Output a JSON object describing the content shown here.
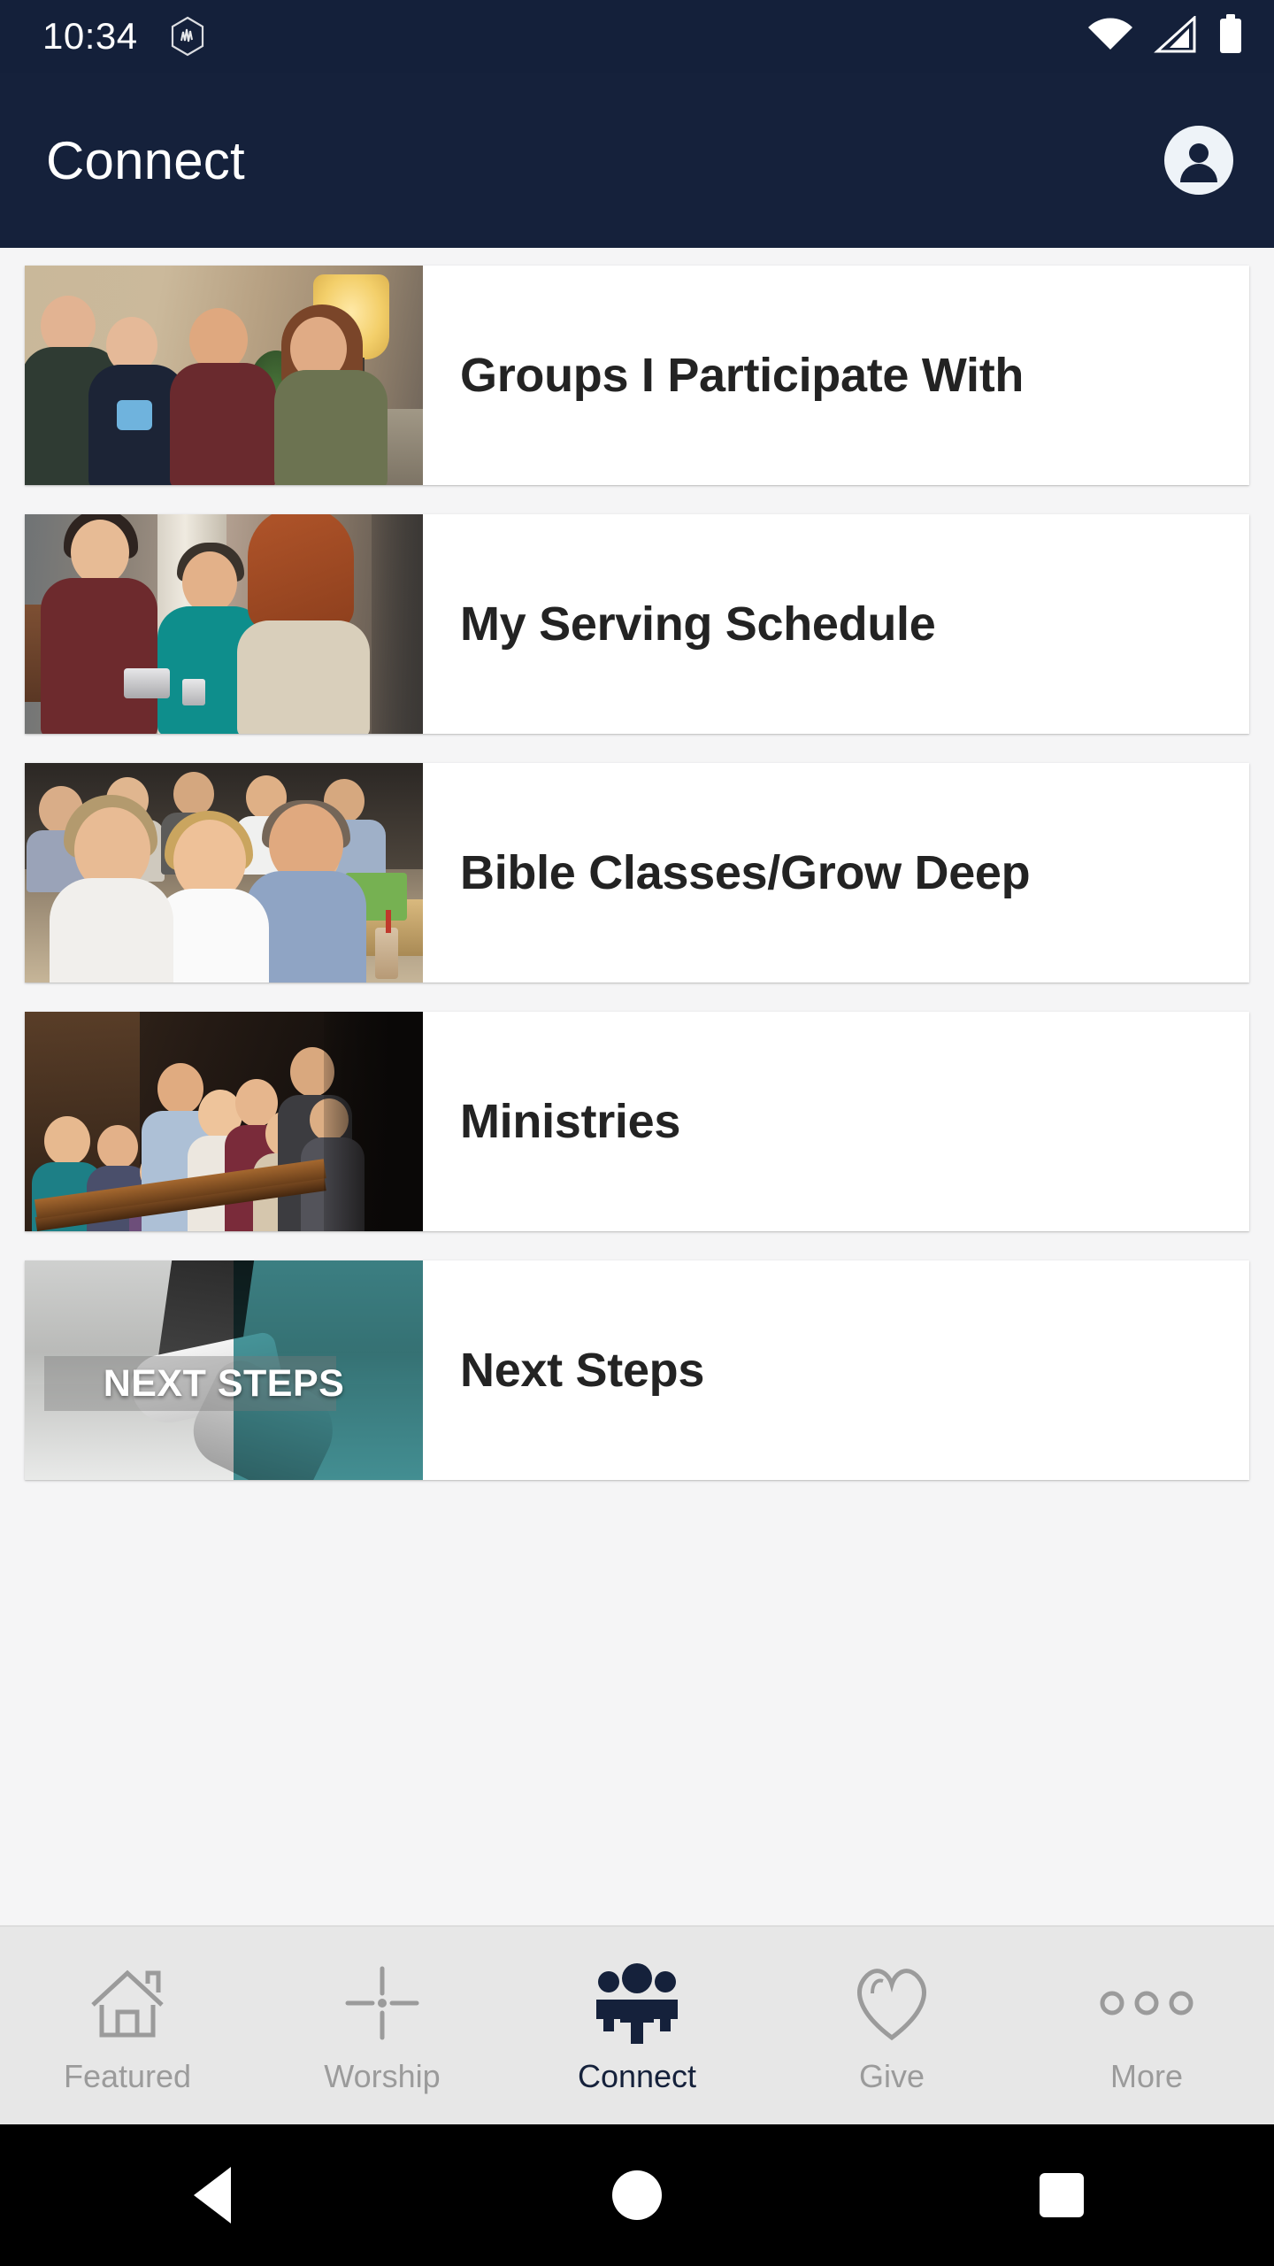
{
  "status_bar": {
    "time": "10:34",
    "app_badge_icon": "hexagon-notification-icon",
    "wifi_icon": "wifi-full-icon",
    "signal_icon": "cellular-signal-icon",
    "battery_icon": "battery-full-icon"
  },
  "app_bar": {
    "title": "Connect",
    "account_icon": "account-circle-icon",
    "background_color": "#15213b"
  },
  "list": {
    "items": [
      {
        "label": "Groups I Participate With",
        "thumb_overlay_text": ""
      },
      {
        "label": "My Serving Schedule",
        "thumb_overlay_text": ""
      },
      {
        "label": "Bible Classes/Grow Deep",
        "thumb_overlay_text": ""
      },
      {
        "label": "Ministries",
        "thumb_overlay_text": ""
      },
      {
        "label": "Next Steps",
        "thumb_overlay_text": "NEXT STEPS"
      }
    ]
  },
  "tab_bar": {
    "active_color": "#15213b",
    "inactive_color": "#9b9b9b",
    "tabs": [
      {
        "label": "Featured",
        "icon": "home-icon",
        "active": false
      },
      {
        "label": "Worship",
        "icon": "cross-icon",
        "active": false
      },
      {
        "label": "Connect",
        "icon": "people-group-icon",
        "active": true
      },
      {
        "label": "Give",
        "icon": "heart-icon",
        "active": false
      },
      {
        "label": "More",
        "icon": "three-dots-icon",
        "active": false
      }
    ]
  },
  "system_nav": {
    "back_label": "Back",
    "home_label": "Home",
    "recents_label": "Recent apps"
  }
}
